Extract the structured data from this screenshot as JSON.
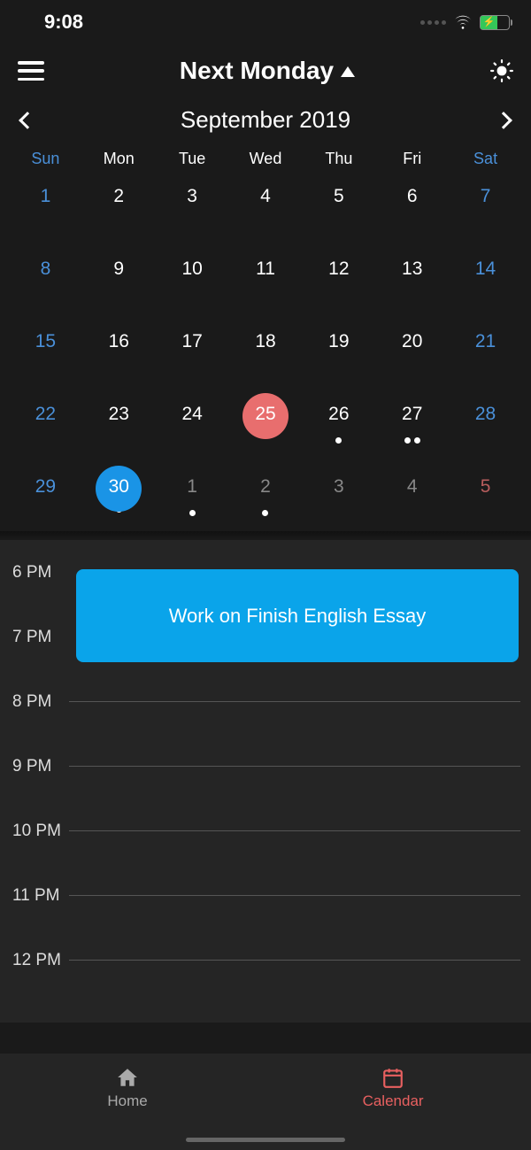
{
  "status": {
    "time": "9:08"
  },
  "header": {
    "title": "Next Monday"
  },
  "month": {
    "label": "September 2019"
  },
  "weekdays": [
    "Sun",
    "Mon",
    "Tue",
    "Wed",
    "Thu",
    "Fri",
    "Sat"
  ],
  "weeks": [
    [
      {
        "n": "1",
        "wknd": true
      },
      {
        "n": "2"
      },
      {
        "n": "3"
      },
      {
        "n": "4"
      },
      {
        "n": "5"
      },
      {
        "n": "6"
      },
      {
        "n": "7",
        "wknd": true
      }
    ],
    [
      {
        "n": "8",
        "wknd": true
      },
      {
        "n": "9"
      },
      {
        "n": "10"
      },
      {
        "n": "11"
      },
      {
        "n": "12"
      },
      {
        "n": "13"
      },
      {
        "n": "14",
        "wknd": true
      }
    ],
    [
      {
        "n": "15",
        "wknd": true
      },
      {
        "n": "16"
      },
      {
        "n": "17"
      },
      {
        "n": "18"
      },
      {
        "n": "19"
      },
      {
        "n": "20"
      },
      {
        "n": "21",
        "wknd": true
      }
    ],
    [
      {
        "n": "22",
        "wknd": true
      },
      {
        "n": "23"
      },
      {
        "n": "24"
      },
      {
        "n": "25",
        "today": true
      },
      {
        "n": "26",
        "dots": 1
      },
      {
        "n": "27",
        "dots": 2
      },
      {
        "n": "28",
        "wknd": true
      }
    ],
    [
      {
        "n": "29",
        "wknd": true
      },
      {
        "n": "30",
        "selected": true,
        "dots": 1
      },
      {
        "n": "1",
        "nm": true,
        "dots": 1
      },
      {
        "n": "2",
        "nm": true,
        "dots": 1
      },
      {
        "n": "3",
        "nm": true
      },
      {
        "n": "4",
        "nm": true
      },
      {
        "n": "5",
        "nm": true,
        "wknd": true
      }
    ]
  ],
  "hours": [
    "6 PM",
    "7 PM",
    "8 PM",
    "9 PM",
    "10 PM",
    "11 PM",
    "12 PM"
  ],
  "event": {
    "title": "Work on Finish English Essay"
  },
  "tabs": {
    "home": "Home",
    "calendar": "Calendar"
  }
}
